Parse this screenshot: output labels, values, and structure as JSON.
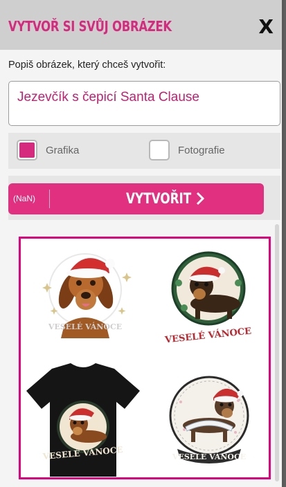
{
  "dialog": {
    "title": "VYTVOŘ SI SVŮJ OBRÁZEK",
    "close_label": "X"
  },
  "prompt": {
    "label": "Popiš obrázek, který chceš vytvořit:",
    "value": "Jezevčík s čepicí Santa Clause"
  },
  "options": [
    {
      "label": "Grafika",
      "checked": true
    },
    {
      "label": "Fotografie",
      "checked": false
    }
  ],
  "create": {
    "counter": "(NaN)",
    "label": "VYTVOŘIT"
  },
  "gallery": {
    "items": [
      {
        "name": "dachshund-santa-hat-sketch",
        "caption": "VESELÉ VÁNOCE"
      },
      {
        "name": "dachshund-green-wreath-badge",
        "caption": "VESELÉ VÁNOCE"
      },
      {
        "name": "black-tshirt-dachshund",
        "caption": "VESELÉ VÁNOCE"
      },
      {
        "name": "dachshund-scarf-badge",
        "caption": "VESELÉ VÁNOCE"
      }
    ]
  },
  "colors": {
    "accent": "#d52a7e",
    "button": "#e0307f",
    "gallery_border": "#e6007e"
  }
}
